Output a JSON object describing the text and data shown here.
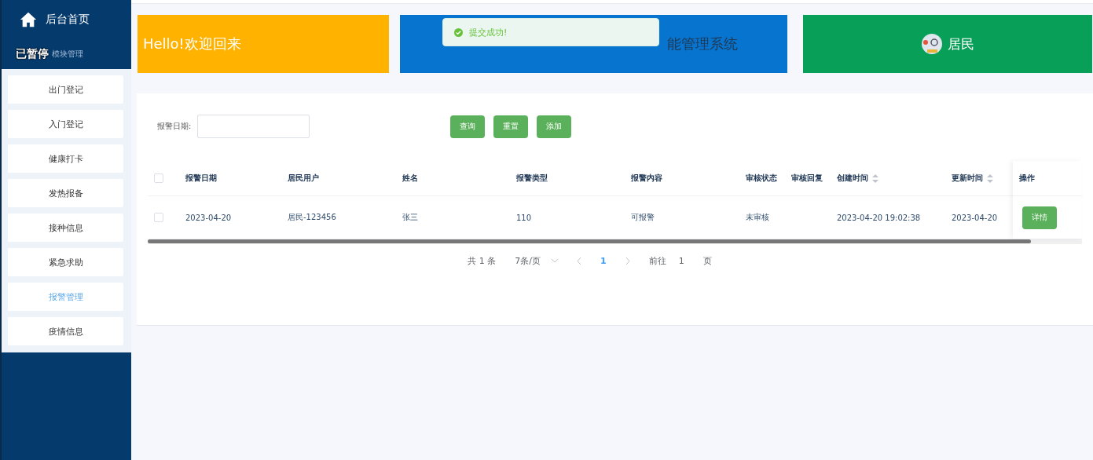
{
  "sidebar": {
    "home": "后台首页",
    "section": "模块管理",
    "overlay_label": "已暂停",
    "items": [
      {
        "label": "出门登记",
        "selected": false
      },
      {
        "label": "入门登记",
        "selected": false
      },
      {
        "label": "健康打卡",
        "selected": false
      },
      {
        "label": "发热报备",
        "selected": false
      },
      {
        "label": "接种信息",
        "selected": false
      },
      {
        "label": "紧急求助",
        "selected": false
      },
      {
        "label": "报警管理",
        "selected": true
      },
      {
        "label": "疫情信息",
        "selected": false
      }
    ]
  },
  "banners": {
    "greeting": "Hello!欢迎回来",
    "system_title": "能管理系统",
    "role": "居民"
  },
  "toast": {
    "message": "提交成功!"
  },
  "search": {
    "label": "报警日期:",
    "buttons": [
      "查询",
      "重置",
      "添加"
    ]
  },
  "table": {
    "select_all_checked": false,
    "columns": [
      {
        "label": "报警日期",
        "sortable": false
      },
      {
        "label": "居民用户",
        "sortable": false
      },
      {
        "label": "姓名",
        "sortable": false
      },
      {
        "label": "报警类型",
        "sortable": false
      },
      {
        "label": "报警内容",
        "sortable": false
      },
      {
        "label": "审核状态",
        "sortable": false
      },
      {
        "label": "审核回复",
        "sortable": false
      },
      {
        "label": "创建时间",
        "sortable": true
      },
      {
        "label": "更新时间",
        "sortable": true
      }
    ],
    "action_header": "操作",
    "rows": [
      {
        "checked": false,
        "cells": [
          "2023-04-20",
          "居民-123456",
          "张三",
          "110",
          "可报警",
          "未审核",
          "",
          "2023-04-20 19:02:38",
          "2023-04-20"
        ],
        "action": "详情"
      }
    ]
  },
  "pagination": {
    "total": "共 1 条",
    "page_size": "7条/页",
    "current": "1",
    "goto_label": "前往",
    "goto_value": "1",
    "pages_label": "页"
  }
}
